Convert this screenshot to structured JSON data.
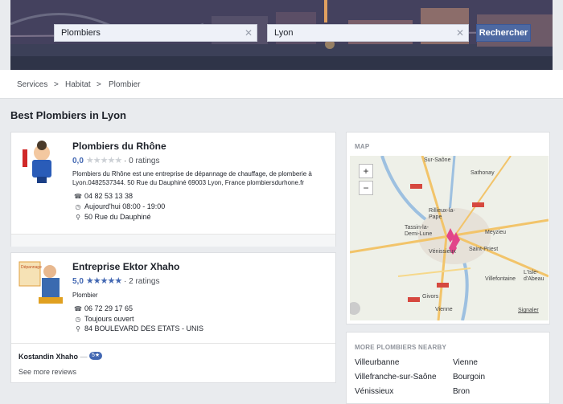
{
  "search": {
    "what_value": "Plombiers",
    "where_value": "Lyon",
    "button_label": "Rechercher"
  },
  "breadcrumb": {
    "items": [
      "Services",
      "Habitat",
      "Plombier"
    ],
    "separator": ">"
  },
  "page_title": "Best Plombiers in Lyon",
  "listings": [
    {
      "name": "Plombiers du Rhône",
      "score": "0,0",
      "ratings": "· 0 ratings",
      "stars_filled": 0,
      "description": "Plombiers du Rhône est une entreprise de dépannage de chauffage, de plomberie à Lyon.0482537344. 50 Rue du Dauphiné 69003 Lyon, France plombiersdurhone.fr",
      "phone": "04 82 53 13 38",
      "hours": "Aujourd'hui 08:00 - 19:00",
      "address": "50 Rue du Dauphiné"
    },
    {
      "name": "Entreprise Ektor Xhaho",
      "score": "5,0",
      "ratings": "· 2 ratings",
      "stars_filled": 5,
      "category": "Plombier",
      "phone": "06 72 29 17 65",
      "hours": "Toujours ouvert",
      "address": "84 BOULEVARD DES ETATS - UNIS",
      "review": {
        "author": "Kostandin Xhaho",
        "dash": "—",
        "badge": "5★"
      },
      "see_more": "See more reviews"
    }
  ],
  "map": {
    "heading": "MAP",
    "zoom_in": "+",
    "zoom_out": "−",
    "attribution": "Signaler",
    "cities": [
      "Sathonay",
      "Rillieux-la-Pape",
      "Tassin-la-Demi-Lune",
      "Meyzieu",
      "Vénissieux",
      "Saint-Priest",
      "Givors",
      "Villefontaine",
      "L'Isle-d'Abeau",
      "Vienne",
      "Sur-Saône"
    ]
  },
  "nearby": {
    "heading": "MORE PLOMBIERS NEARBY",
    "col1": [
      "Villeurbanne",
      "Villefranche-sur-Saône",
      "Vénissieux"
    ],
    "col2": [
      "Vienne",
      "Bourgoin",
      "Bron"
    ]
  },
  "colors": {
    "brand": "#4267b2",
    "button": "#4e69a2",
    "page_bg": "#e9ebee"
  }
}
